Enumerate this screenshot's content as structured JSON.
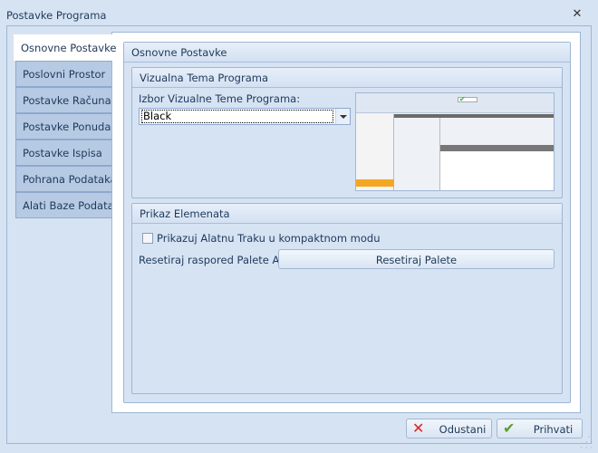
{
  "window": {
    "title": "Postavke Programa",
    "close_icon": "close-icon"
  },
  "tabs": [
    {
      "label": "Osnovne Postavke",
      "active": true
    },
    {
      "label": "Poslovni Prostor"
    },
    {
      "label": "Postavke Računa"
    },
    {
      "label": "Postavke Ponuda"
    },
    {
      "label": "Postavke Ispisa"
    },
    {
      "label": "Pohrana Podataka"
    },
    {
      "label": "Alati Baze Podataka"
    }
  ],
  "main": {
    "title": "Osnovne Postavke",
    "theme_group": {
      "title": "Vizualna Tema Programa",
      "label": "Izbor Vizualne Teme Programa:",
      "selected": "Black"
    },
    "display_group": {
      "title": "Prikaz Elemenata",
      "checkbox_label": "Prikazuj Alatnu Traku u kompaktnom modu",
      "checked": false,
      "reset_label": "Resetiraj raspored Palete Alata",
      "reset_button": "Resetiraj Palete"
    }
  },
  "footer": {
    "cancel": "Odustani",
    "accept": "Prihvati",
    "cancel_color": "#e02020",
    "accept_color": "#5aa02c"
  }
}
